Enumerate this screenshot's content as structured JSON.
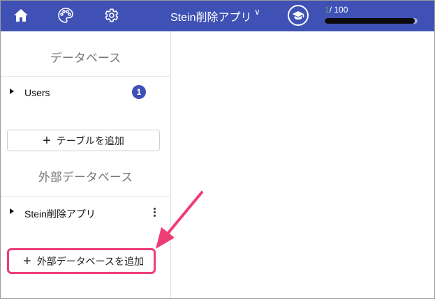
{
  "header": {
    "icons": [
      "home-icon",
      "palette-icon",
      "gear-icon",
      "graduation-cap-icon"
    ],
    "app_title": "Stein削除アプリ",
    "caret": "∨",
    "progress_current": "1",
    "progress_total": "/ 100",
    "progress_fraction": 0.01
  },
  "sidebar": {
    "database_title": "データベース",
    "tables": [
      {
        "label": "Users",
        "badge": "1"
      }
    ],
    "add_table_label": "テーブルを追加",
    "external_title": "外部データベース",
    "external_dbs": [
      {
        "label": "Stein削除アプリ"
      }
    ],
    "add_external_label": "外部データベースを追加",
    "plus": "+"
  },
  "colors": {
    "header_bg": "#3f51b5",
    "badge_bg": "#3f51b5",
    "highlight": "#ee3d74",
    "progress_current": "#4caf50"
  }
}
